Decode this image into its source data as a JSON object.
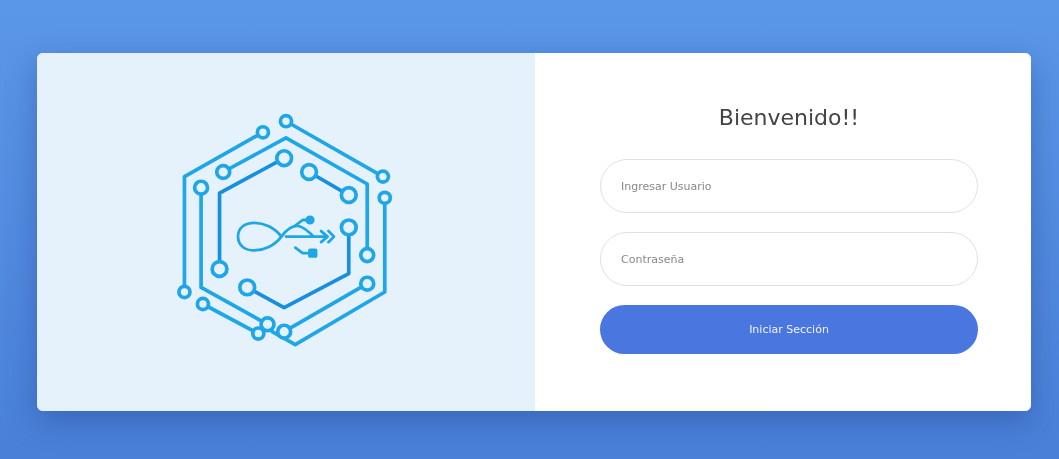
{
  "login": {
    "title": "Bienvenido!!",
    "fields": [
      {
        "placeholder": "Ingresar Usuario"
      },
      {
        "placeholder": "Contraseña"
      }
    ],
    "submit_button": "Iniciar Sección"
  }
}
